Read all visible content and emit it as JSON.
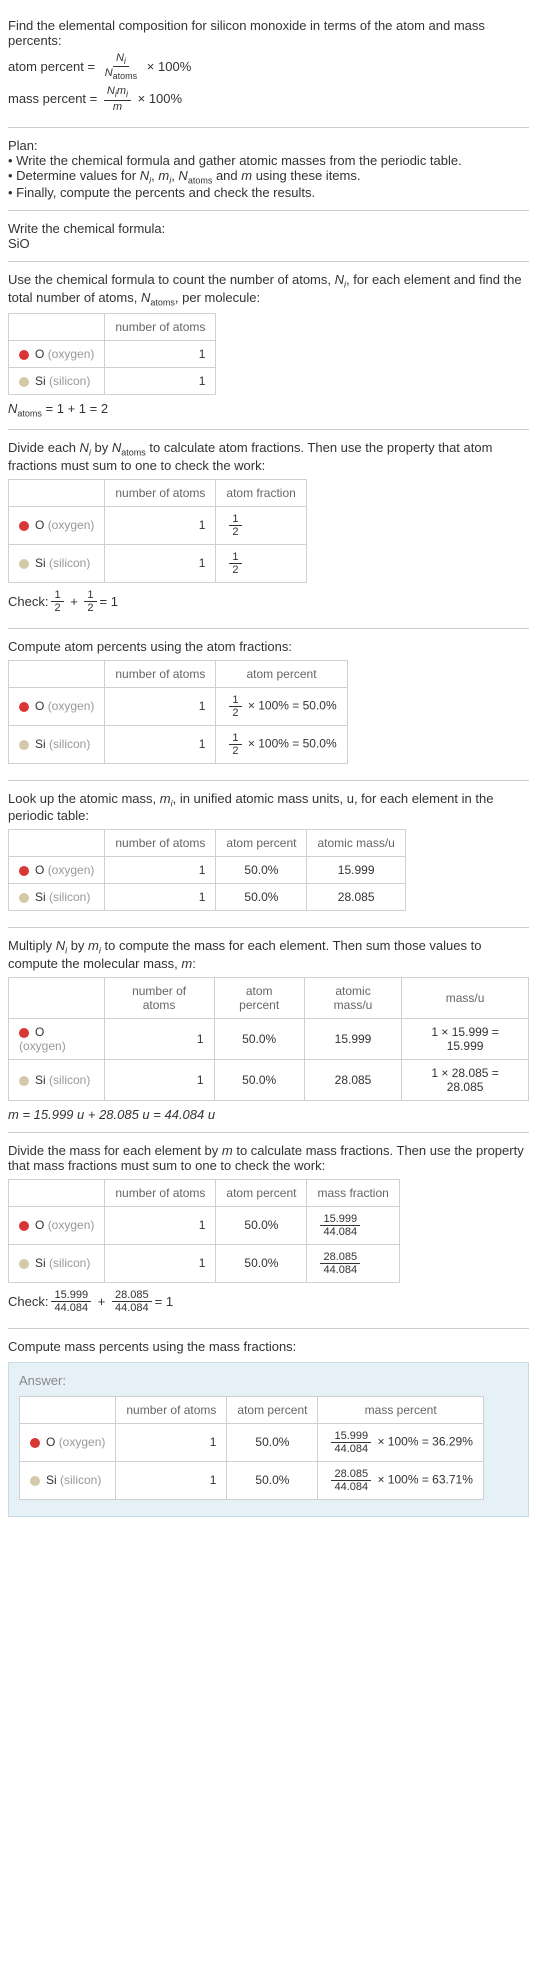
{
  "intro": {
    "line1": "Find the elemental composition for silicon monoxide in terms of the atom and mass percents:",
    "atom_percent_label": "atom percent",
    "mass_percent_label": "mass percent",
    "eq": "=",
    "times100": "× 100%",
    "Ni": "N",
    "i": "i",
    "Natoms": "N",
    "atoms": "atoms",
    "mi": "m",
    "m": "m"
  },
  "plan": {
    "header": "Plan:",
    "b1": "• Write the chemical formula and gather atomic masses from the periodic table.",
    "b2_a": "• Determine values for ",
    "b2_b": " using these items.",
    "b3": "• Finally, compute the percents and check the results.",
    "vars": "N_i, m_i, N_atoms and m"
  },
  "s1": {
    "line1": "Write the chemical formula:",
    "formula": "SiO"
  },
  "s2": {
    "line1_a": "Use the chemical formula to count the number of atoms, ",
    "line1_b": ", for each element and find the total number of atoms, ",
    "line1_c": ", per molecule:",
    "th1": "number of atoms",
    "o_label": "O",
    "o_name": "(oxygen)",
    "o_n": "1",
    "si_label": "Si",
    "si_name": "(silicon)",
    "si_n": "1",
    "total": " = 1 + 1 = 2"
  },
  "s3": {
    "line1_a": "Divide each ",
    "line1_b": " by ",
    "line1_c": " to calculate atom fractions. Then use the property that atom fractions must sum to one to check the work:",
    "th1": "number of atoms",
    "th2": "atom fraction",
    "o_n": "1",
    "si_n": "1",
    "half_num": "1",
    "half_den": "2",
    "check_label": "Check: ",
    "check_eq": " = 1"
  },
  "s4": {
    "line1": "Compute atom percents using the atom fractions:",
    "th1": "number of atoms",
    "th2": "atom percent",
    "o_n": "1",
    "si_n": "1",
    "pct": " × 100% = 50.0%"
  },
  "s5": {
    "line1_a": "Look up the atomic mass, ",
    "line1_b": ", in unified atomic mass units, u, for each element in the periodic table:",
    "th1": "number of atoms",
    "th2": "atom percent",
    "th3": "atomic mass/u",
    "o_n": "1",
    "o_pct": "50.0%",
    "o_mass": "15.999",
    "si_n": "1",
    "si_pct": "50.0%",
    "si_mass": "28.085"
  },
  "s6": {
    "line1_a": "Multiply ",
    "line1_b": " by ",
    "line1_c": " to compute the mass for each element. Then sum those values to compute the molecular mass, ",
    "line1_d": ":",
    "th1": "number of atoms",
    "th2": "atom percent",
    "th3": "atomic mass/u",
    "th4": "mass/u",
    "o_n": "1",
    "o_pct": "50.0%",
    "o_mass": "15.999",
    "o_calc": "1 × 15.999 = 15.999",
    "si_n": "1",
    "si_pct": "50.0%",
    "si_mass": "28.085",
    "si_calc": "1 × 28.085 = 28.085",
    "total": "m = 15.999 u + 28.085 u = 44.084 u"
  },
  "s7": {
    "line1_a": "Divide the mass for each element by ",
    "line1_b": " to calculate mass fractions. Then use the property that mass fractions must sum to one to check the work:",
    "th1": "number of atoms",
    "th2": "atom percent",
    "th3": "mass fraction",
    "o_n": "1",
    "o_pct": "50.0%",
    "o_num": "15.999",
    "o_den": "44.084",
    "si_n": "1",
    "si_pct": "50.0%",
    "si_num": "28.085",
    "si_den": "44.084",
    "check_label": "Check: ",
    "check_eq": " = 1"
  },
  "s8": {
    "line1": "Compute mass percents using the mass fractions:",
    "answer": "Answer:",
    "th1": "number of atoms",
    "th2": "atom percent",
    "th3": "mass percent",
    "o_n": "1",
    "o_pct": "50.0%",
    "o_num": "15.999",
    "o_den": "44.084",
    "o_result": " × 100% = 36.29%",
    "si_n": "1",
    "si_pct": "50.0%",
    "si_num": "28.085",
    "si_den": "44.084",
    "si_result": " × 100% = 63.71%"
  }
}
